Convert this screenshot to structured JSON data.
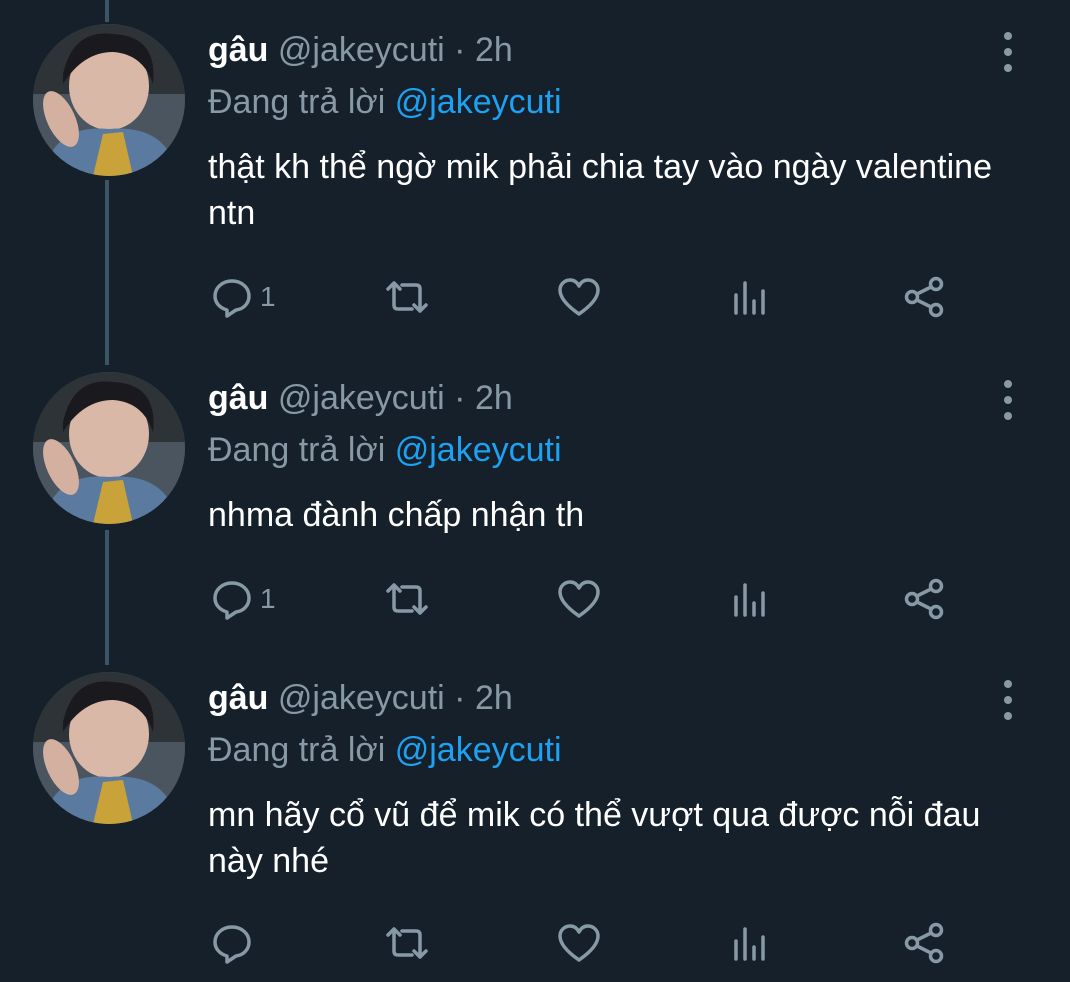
{
  "tweets": [
    {
      "name": "gâu",
      "handle": "@jakeycuti",
      "separator": "·",
      "time": "2h",
      "replying_prefix": "Đang trả lời",
      "replying_to": "@jakeycuti",
      "text": "thật kh thể ngờ mik phải chia tay vào ngày valentine ntn",
      "reply_count": "1",
      "retweet_count": "",
      "like_count": ""
    },
    {
      "name": "gâu",
      "handle": "@jakeycuti",
      "separator": "·",
      "time": "2h",
      "replying_prefix": "Đang trả lời",
      "replying_to": "@jakeycuti",
      "text": "nhma đành chấp nhận th",
      "reply_count": "1",
      "retweet_count": "",
      "like_count": ""
    },
    {
      "name": "gâu",
      "handle": "@jakeycuti",
      "separator": "·",
      "time": "2h",
      "replying_prefix": "Đang trả lời",
      "replying_to": "@jakeycuti",
      "text": "mn hãy cổ vũ để mik có thể vượt qua được nỗi đau này nhé",
      "reply_count": "",
      "retweet_count": "",
      "like_count": ""
    }
  ],
  "icons": {
    "reply": "reply-icon",
    "retweet": "retweet-icon",
    "like": "heart-icon",
    "analytics": "analytics-icon",
    "share": "share-icon",
    "more": "more-vertical-icon"
  },
  "colors": {
    "background": "#15202b",
    "text": "#ffffff",
    "secondary": "#8899a6",
    "link": "#1da1f2",
    "thread_line": "#3d5466"
  }
}
